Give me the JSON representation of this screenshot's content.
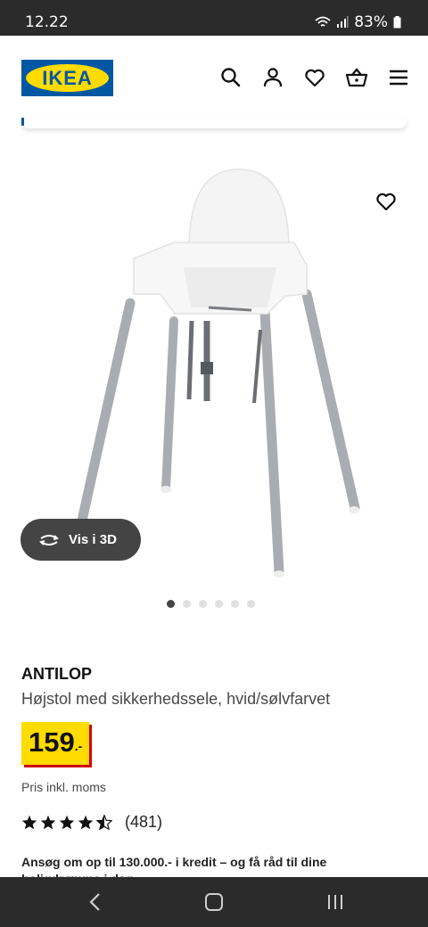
{
  "status": {
    "time": "12.22",
    "battery": "83%"
  },
  "header": {
    "logo_text": "IKEA",
    "icons": [
      "search-icon",
      "user-icon",
      "heart-icon",
      "basket-icon",
      "menu-icon"
    ]
  },
  "product": {
    "name": "ANTILOP",
    "description": "Højstol med sikkerhedssele, hvid/sølvfarvet",
    "price_integer": "159",
    "price_decimal": ".-",
    "vat_note": "Pris inkl. moms",
    "rating_value": 4.5,
    "rating_count": "(481)",
    "credit_text_line1": "Ansøg om op til 130.000.- i kredit – og få råd til dine",
    "credit_text_line2": "boligdrømme i dag"
  },
  "gallery": {
    "view3d_label": "Vis i 3D",
    "image_count": 6,
    "active_index": 0
  },
  "colors": {
    "ikea_blue": "#0058a3",
    "ikea_yellow": "#ffdb00",
    "price_red": "#cc0008",
    "bar_dark": "#2b2b2b"
  }
}
